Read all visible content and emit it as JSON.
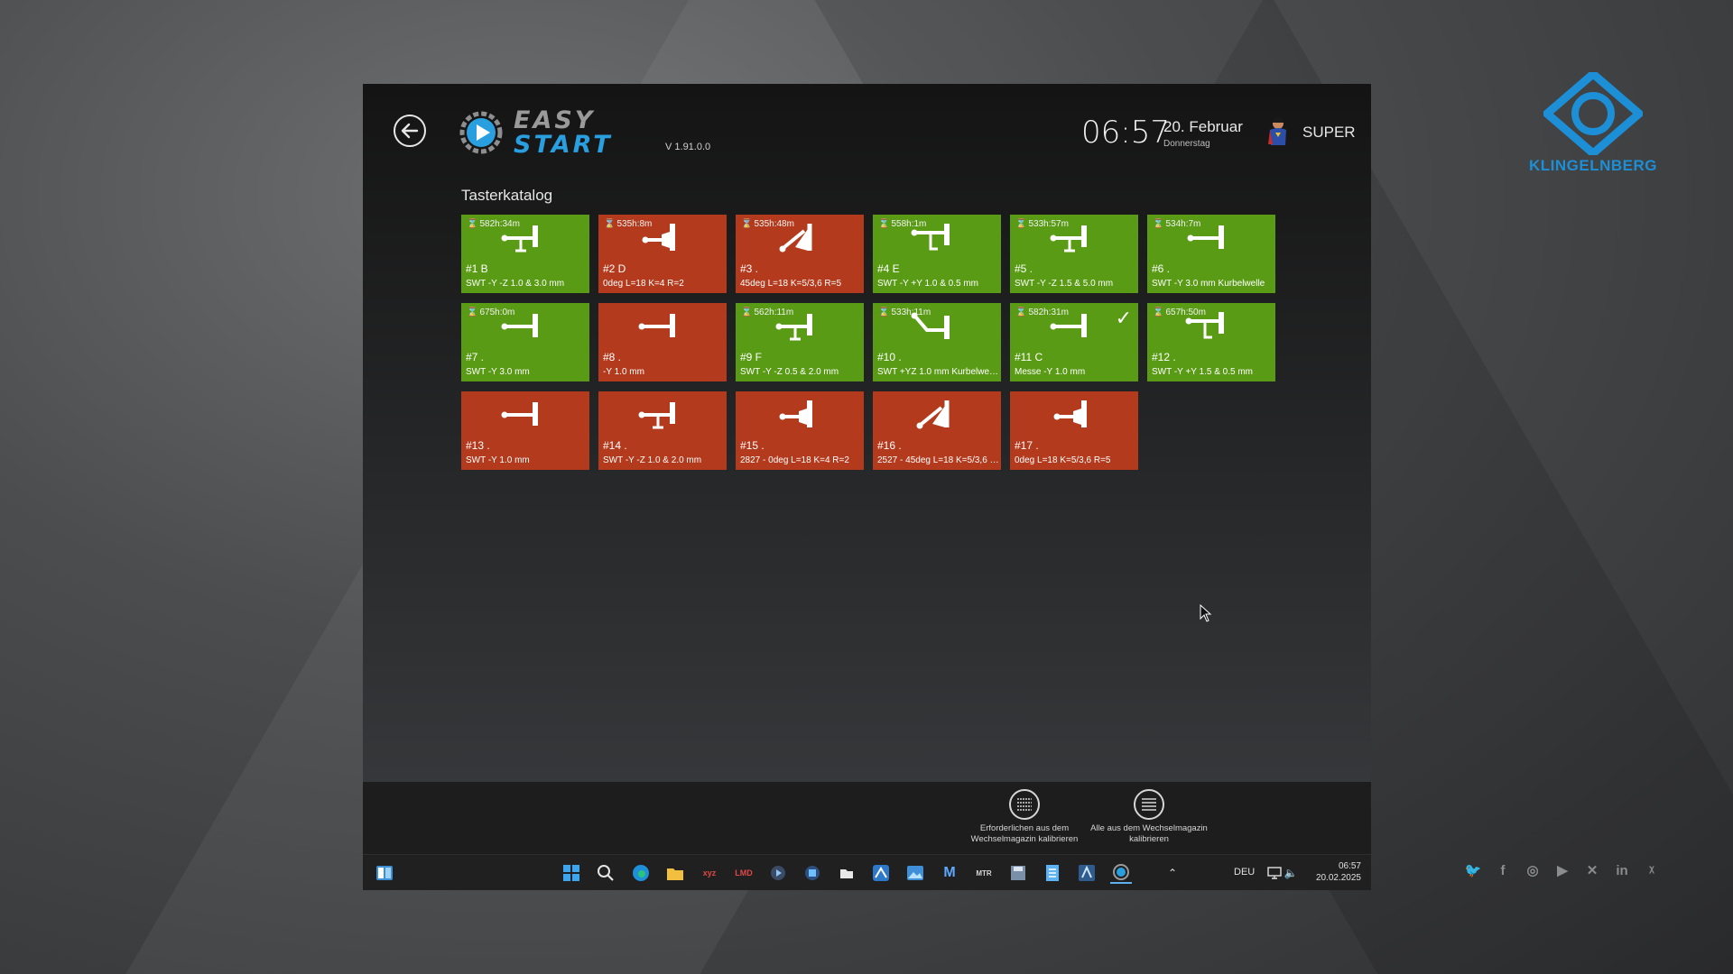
{
  "brand": {
    "name": "KLINGELNBERG",
    "color": "#1c8fd6"
  },
  "social": [
    "twitter-icon",
    "facebook-icon",
    "instagram-icon",
    "youtube-icon",
    "xing-icon",
    "linkedin-icon",
    "x-icon"
  ],
  "app": {
    "logo_word1": "EASY",
    "logo_word2": "START",
    "version": "V 1.91.0.0",
    "time": "06:57",
    "date": "20. Februar",
    "weekday": "Donnerstag",
    "user": "SUPER",
    "section_title": "Tasterkatalog"
  },
  "tiles": [
    {
      "timer": "582h:34m",
      "num": "#1 B",
      "desc": "SWT -Y -Z 1.0 & 3.0 mm",
      "status": "green",
      "probe": "t-cross"
    },
    {
      "timer": "535h:8m",
      "num": "#2 D",
      "desc": "0deg L=18 K=4 R=2",
      "status": "red",
      "probe": "bulb"
    },
    {
      "timer": "535h:48m",
      "num": "#3 .",
      "desc": "45deg L=18 K=5/3,6 R=5",
      "status": "red",
      "probe": "angled"
    },
    {
      "timer": "558h:1m",
      "num": "#4 E",
      "desc": "SWT -Y +Y 1.0 & 0.5 mm",
      "status": "green",
      "probe": "t-hook"
    },
    {
      "timer": "533h:57m",
      "num": "#5 .",
      "desc": "SWT -Y -Z 1.5 & 5.0 mm",
      "status": "green",
      "probe": "t-cross"
    },
    {
      "timer": "534h:7m",
      "num": "#6 .",
      "desc": "SWT -Y 3.0 mm Kurbelwelle",
      "status": "green",
      "probe": "t-simple"
    },
    {
      "timer": "675h:0m",
      "num": "#7 .",
      "desc": "SWT -Y 3.0 mm",
      "status": "green",
      "probe": "t-simple"
    },
    {
      "timer": "",
      "num": "#8 .",
      "desc": "-Y 1.0 mm",
      "status": "red",
      "probe": "t-simple"
    },
    {
      "timer": "562h:11m",
      "num": "#9 F",
      "desc": "SWT -Y -Z 0.5 & 2.0 mm",
      "status": "green",
      "probe": "t-cross"
    },
    {
      "timer": "533h:11m",
      "num": "#10 .",
      "desc": "SWT +YZ 1.0 mm Kurbelwelle...",
      "status": "green",
      "probe": "bent"
    },
    {
      "timer": "582h:31m",
      "num": "#11 C",
      "desc": "Messe -Y 1.0 mm",
      "status": "green",
      "probe": "t-simple",
      "checked": true
    },
    {
      "timer": "657h:50m",
      "num": "#12 .",
      "desc": "SWT -Y +Y 1.5 & 0.5 mm",
      "status": "green",
      "probe": "t-hook"
    },
    {
      "timer": "",
      "num": "#13 .",
      "desc": "SWT -Y 1.0 mm",
      "status": "red",
      "probe": "t-simple"
    },
    {
      "timer": "",
      "num": "#14 .",
      "desc": "SWT -Y -Z 1.0 & 2.0 mm",
      "status": "red",
      "probe": "t-cross"
    },
    {
      "timer": "",
      "num": "#15 .",
      "desc": "2827 - 0deg L=18 K=4 R=2",
      "status": "red",
      "probe": "bulb"
    },
    {
      "timer": "",
      "num": "#16 .",
      "desc": "2527 - 45deg L=18 K=5/3,6 R...",
      "status": "red",
      "probe": "angled"
    },
    {
      "timer": "",
      "num": "#17 .",
      "desc": "0deg L=18 K=5/3,6 R=5",
      "status": "red",
      "probe": "bulb"
    }
  ],
  "colors": {
    "green": "#5a9b16",
    "red": "#b33a1c"
  },
  "buttons": {
    "cal_required": "Erforderlichen aus dem Wechselmagazin kalibrieren",
    "cal_all": "Alle aus dem Wechselmagazin kalibrieren"
  },
  "taskbar": {
    "lang": "DEU",
    "time": "06:57",
    "date": "20.02.2025",
    "icons": [
      "widgets-icon",
      "windows-start-icon",
      "search-icon",
      "edge-icon",
      "file-explorer-icon",
      "lmd-xyz-icon",
      "lmd-app-icon",
      "media-player-icon",
      "app-icon",
      "folder-icon",
      "image-editor-icon",
      "photos-icon",
      "mi-icon",
      "mtr-icon",
      "save-icon",
      "notepad-icon",
      "paint-icon",
      "easystart-icon"
    ]
  }
}
